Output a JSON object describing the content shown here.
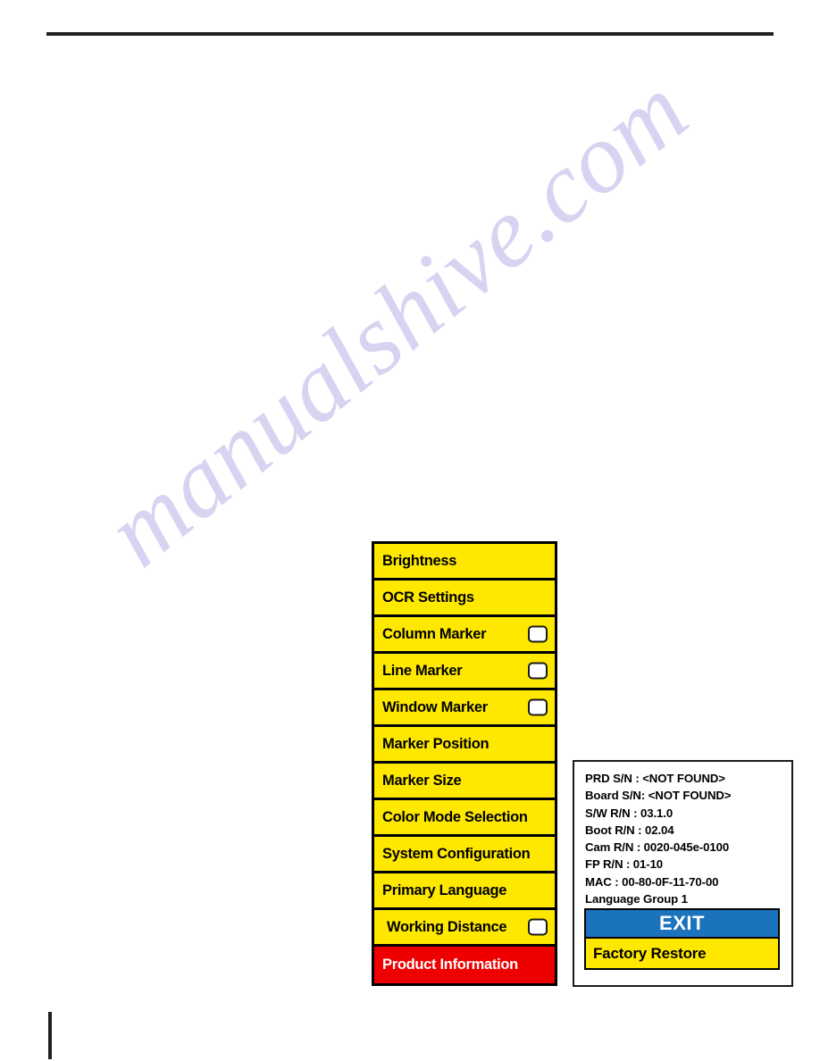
{
  "page": {
    "watermark_text": "manualshive.com"
  },
  "osd_menu": {
    "items": [
      {
        "label": "Brightness",
        "checkbox": false,
        "highlight": false,
        "indented": false
      },
      {
        "label": "OCR Settings",
        "checkbox": false,
        "highlight": false,
        "indented": false
      },
      {
        "label": "Column Marker",
        "checkbox": true,
        "highlight": false,
        "indented": false
      },
      {
        "label": "Line Marker",
        "checkbox": true,
        "highlight": false,
        "indented": false
      },
      {
        "label": "Window Marker",
        "checkbox": true,
        "highlight": false,
        "indented": false
      },
      {
        "label": "Marker Position",
        "checkbox": false,
        "highlight": false,
        "indented": false
      },
      {
        "label": "Marker Size",
        "checkbox": false,
        "highlight": false,
        "indented": false
      },
      {
        "label": "Color Mode Selection",
        "checkbox": false,
        "highlight": false,
        "indented": false
      },
      {
        "label": "System Configuration",
        "checkbox": false,
        "highlight": false,
        "indented": false
      },
      {
        "label": "Primary Language",
        "checkbox": false,
        "highlight": false,
        "indented": false
      },
      {
        "label": "Working Distance",
        "checkbox": true,
        "highlight": false,
        "indented": true
      },
      {
        "label": "Product Information",
        "checkbox": false,
        "highlight": true,
        "indented": false
      }
    ],
    "colors": {
      "background": "#ffe800",
      "highlight": "#ee0000",
      "border": "#000000",
      "text": "#000000",
      "highlight_text": "#ffffff"
    }
  },
  "info_panel": {
    "lines": [
      "PRD S/N : <NOT FOUND>",
      "Board S/N: <NOT FOUND>",
      "S/W R/N : 03.1.0",
      "Boot R/N : 02.04",
      "Cam R/N : 0020-045e-0100",
      "FP R/N : 01-10",
      "MAC : 00-80-0F-11-70-00",
      "Language Group 1"
    ],
    "exit_label": "EXIT",
    "factory_restore_label": "Factory Restore",
    "colors": {
      "exit_background": "#1b72bd",
      "exit_text": "#ffffff",
      "factory_background": "#ffe800",
      "panel_background": "#ffffff",
      "border": "#1a1a1a"
    }
  }
}
